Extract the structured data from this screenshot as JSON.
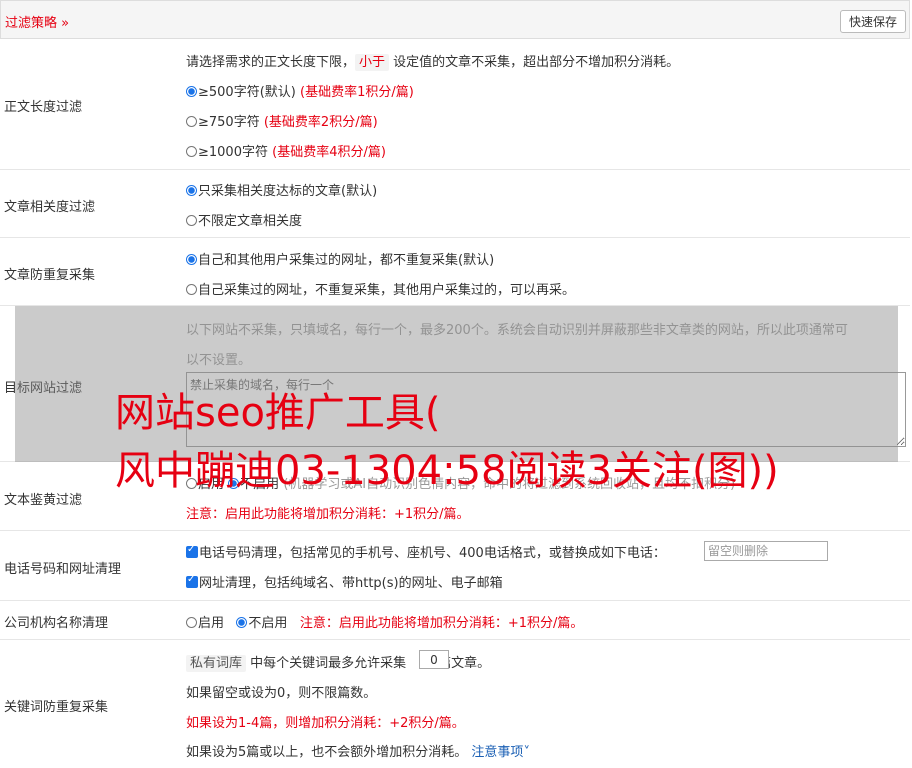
{
  "header": {
    "title": "过滤策略",
    "save_label": "快速保存"
  },
  "length_filter": {
    "label": "正文长度过滤",
    "desc_before": "请选择需求的正文长度下限，",
    "desc_tag": "小于",
    "desc_after": "设定值的文章不采集，超出部分不增加积分消耗。",
    "options": [
      {
        "label": "≥500字符(默认)",
        "note": "(基础费率1积分/篇)",
        "checked": true
      },
      {
        "label": "≥750字符",
        "note": "(基础费率2积分/篇)",
        "checked": false
      },
      {
        "label": "≥1000字符",
        "note": "(基础费率4积分/篇)",
        "checked": false
      }
    ]
  },
  "relevance_filter": {
    "label": "文章相关度过滤",
    "options": [
      {
        "label": "只采集相关度达标的文章(默认)",
        "checked": true
      },
      {
        "label": "不限定文章相关度",
        "checked": false
      }
    ]
  },
  "dedupe_filter": {
    "label": "文章防重复采集",
    "options": [
      {
        "label": "自己和其他用户采集过的网址，都不重复采集(默认)",
        "checked": true
      },
      {
        "label": "自己采集过的网址，不重复采集，其他用户采集过的，可以再采。",
        "checked": false
      }
    ]
  },
  "site_filter": {
    "label": "目标网站过滤",
    "desc_line1": "以下网站不采集，只填域名，每行一个，最多200个。系统会自动识别并屏蔽那些非文章类的网站，所以此项通常可",
    "desc_line2": "以不设置。",
    "placeholder": "禁止采集的域名，每行一个"
  },
  "porn_filter": {
    "label": "文本鉴黄过滤",
    "option_on": "启用",
    "option_off": "不启用",
    "desc": "(机器学习或AI自动识别色情内容，命中的将过滤到系统回收站，且均不扣积分)",
    "note": "注意：启用此功能将增加积分消耗：+1积分/篇。"
  },
  "contact_filter": {
    "label": "电话号码和网址清理",
    "phone_label": "电话号码清理，包括常见的手机号、座机号、400电话格式，或替换成如下电话：",
    "phone_placeholder": "留空则删除",
    "url_label": "网址清理，包括纯域名、带http(s)的网址、电子邮箱"
  },
  "org_filter": {
    "label": "公司机构名称清理",
    "option_on": "启用",
    "option_off": "不启用",
    "note": "注意：启用此功能将增加积分消耗：+1积分/篇。"
  },
  "keyword_filter": {
    "label": "关键词防重复采集",
    "tag": "私有词库",
    "text_before": "中每个关键词最多允许采集",
    "value": "0",
    "text_after": "篇文章。",
    "line2": "如果留空或设为0，则不限篇数。",
    "line3": "如果设为1-4篇，则增加积分消耗：+2积分/篇。",
    "line4": "如果设为5篇或以上，也不会额外增加积分消耗。",
    "link": "注意事项"
  },
  "watermark": {
    "line1": "网站seo推广工具(",
    "line2": "风中蹦迪03-1304:58阅读3关注(图))"
  },
  "colors": {
    "accent": "#e60012",
    "radio": "#1a73e8",
    "link": "#1a5fb4"
  }
}
